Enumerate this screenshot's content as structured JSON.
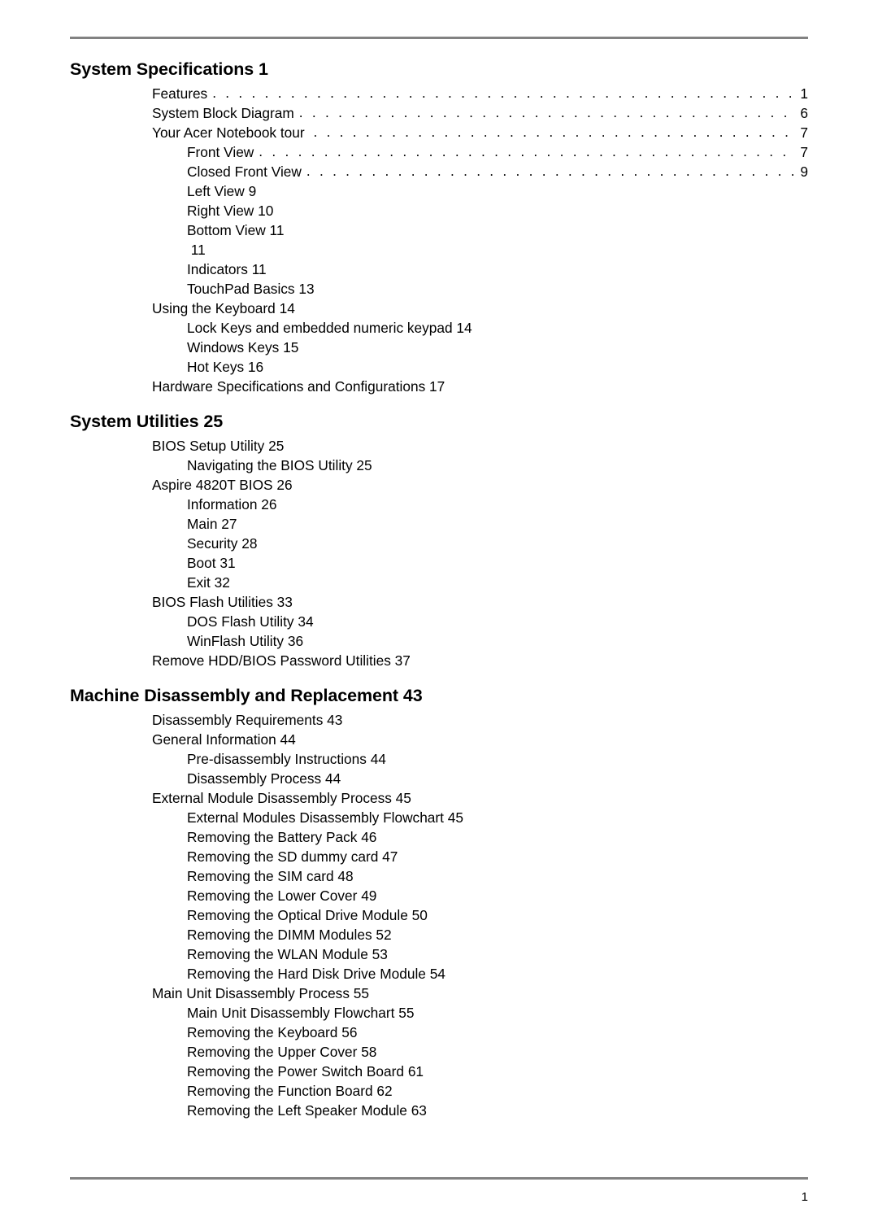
{
  "document": {
    "folio": "1",
    "leader_char": "."
  },
  "sections": [
    {
      "heading": "System Specifications 1",
      "entries": [
        {
          "level": 1,
          "text": "Features",
          "page": "1",
          "leader": true
        },
        {
          "level": 1,
          "text": "System Block Diagram",
          "page": "6",
          "leader": true
        },
        {
          "level": 1,
          "text": "Your Acer Notebook tour ",
          "page": "7",
          "leader": true
        },
        {
          "level": 2,
          "text": "Front View",
          "page": "7",
          "leader": true
        },
        {
          "level": 2,
          "text": "Closed Front View",
          "page": "9",
          "leader": true
        },
        {
          "level": 2,
          "text": "Left View 9",
          "page": "",
          "leader": false
        },
        {
          "level": 2,
          "text": "Right View 10",
          "page": "",
          "leader": false
        },
        {
          "level": 2,
          "text": "Bottom View 11",
          "page": "",
          "leader": false
        },
        {
          "level": 2,
          "text": " 11",
          "page": "",
          "leader": false
        },
        {
          "level": 2,
          "text": "Indicators 11",
          "page": "",
          "leader": false
        },
        {
          "level": 2,
          "text": "TouchPad Basics 13",
          "page": "",
          "leader": false
        },
        {
          "level": 1,
          "text": "Using the Keyboard 14",
          "page": "",
          "leader": false
        },
        {
          "level": 2,
          "text": "Lock Keys and embedded numeric keypad 14",
          "page": "",
          "leader": false
        },
        {
          "level": 2,
          "text": "Windows Keys 15",
          "page": "",
          "leader": false
        },
        {
          "level": 2,
          "text": "Hot Keys 16",
          "page": "",
          "leader": false
        },
        {
          "level": 1,
          "text": "Hardware Specifications and Configurations 17",
          "page": "",
          "leader": false
        }
      ]
    },
    {
      "heading": "System Utilities 25",
      "entries": [
        {
          "level": 1,
          "text": "BIOS Setup Utility 25",
          "page": "",
          "leader": false
        },
        {
          "level": 2,
          "text": "Navigating the BIOS Utility 25",
          "page": "",
          "leader": false
        },
        {
          "level": 1,
          "text": "Aspire 4820T BIOS 26",
          "page": "",
          "leader": false
        },
        {
          "level": 2,
          "text": "Information 26",
          "page": "",
          "leader": false
        },
        {
          "level": 2,
          "text": "Main 27",
          "page": "",
          "leader": false
        },
        {
          "level": 2,
          "text": "Security 28",
          "page": "",
          "leader": false
        },
        {
          "level": 2,
          "text": "Boot 31",
          "page": "",
          "leader": false
        },
        {
          "level": 2,
          "text": "Exit 32",
          "page": "",
          "leader": false
        },
        {
          "level": 1,
          "text": "BIOS Flash Utilities 33",
          "page": "",
          "leader": false
        },
        {
          "level": 2,
          "text": "DOS Flash Utility 34",
          "page": "",
          "leader": false
        },
        {
          "level": 2,
          "text": "WinFlash Utility 36",
          "page": "",
          "leader": false
        },
        {
          "level": 1,
          "text": "Remove HDD/BIOS Password Utilities 37",
          "page": "",
          "leader": false
        }
      ]
    },
    {
      "heading": "Machine Disassembly and Replacement 43",
      "entries": [
        {
          "level": 1,
          "text": "Disassembly Requirements 43",
          "page": "",
          "leader": false
        },
        {
          "level": 1,
          "text": "General Information 44",
          "page": "",
          "leader": false
        },
        {
          "level": 2,
          "text": "Pre-disassembly Instructions 44",
          "page": "",
          "leader": false
        },
        {
          "level": 2,
          "text": "Disassembly Process 44",
          "page": "",
          "leader": false
        },
        {
          "level": 1,
          "text": "External Module Disassembly Process 45",
          "page": "",
          "leader": false
        },
        {
          "level": 2,
          "text": "External Modules Disassembly Flowchart 45",
          "page": "",
          "leader": false
        },
        {
          "level": 2,
          "text": "Removing the Battery Pack 46",
          "page": "",
          "leader": false
        },
        {
          "level": 2,
          "text": "Removing the SD dummy card 47",
          "page": "",
          "leader": false
        },
        {
          "level": 2,
          "text": "Removing the SIM card 48",
          "page": "",
          "leader": false
        },
        {
          "level": 2,
          "text": "Removing the Lower Cover 49",
          "page": "",
          "leader": false
        },
        {
          "level": 2,
          "text": "Removing the Optical Drive Module 50",
          "page": "",
          "leader": false
        },
        {
          "level": 2,
          "text": "Removing the DIMM Modules 52",
          "page": "",
          "leader": false
        },
        {
          "level": 2,
          "text": "Removing the WLAN Module 53",
          "page": "",
          "leader": false
        },
        {
          "level": 2,
          "text": "Removing the Hard Disk Drive Module 54",
          "page": "",
          "leader": false
        },
        {
          "level": 1,
          "text": "Main Unit Disassembly Process 55",
          "page": "",
          "leader": false
        },
        {
          "level": 2,
          "text": "Main Unit Disassembly Flowchart 55",
          "page": "",
          "leader": false
        },
        {
          "level": 2,
          "text": "Removing the Keyboard 56",
          "page": "",
          "leader": false
        },
        {
          "level": 2,
          "text": "Removing the Upper Cover 58",
          "page": "",
          "leader": false
        },
        {
          "level": 2,
          "text": "Removing the Power Switch Board 61",
          "page": "",
          "leader": false
        },
        {
          "level": 2,
          "text": "Removing the Function Board 62",
          "page": "",
          "leader": false
        },
        {
          "level": 2,
          "text": "Removing the Left Speaker Module 63",
          "page": "",
          "leader": false
        }
      ]
    }
  ]
}
